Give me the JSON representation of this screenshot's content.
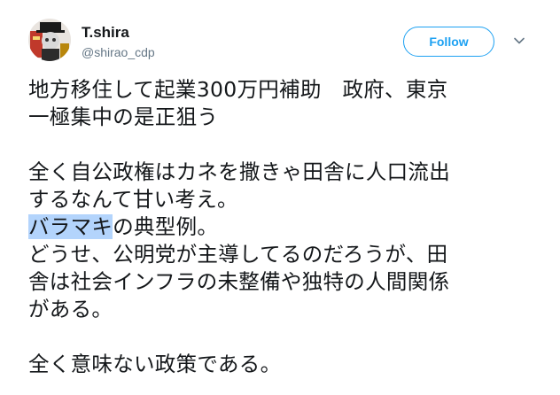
{
  "author": {
    "name": "T.shira",
    "handle": "@shirao_cdp"
  },
  "follow_button": {
    "label": "Follow"
  },
  "icons": {
    "avatar": "avatar-image",
    "menu": "chevron-down-icon"
  },
  "colors": {
    "accent": "#1da1f2",
    "text": "#14171a",
    "secondary": "#657786",
    "selection": "#b3d4fc"
  },
  "tweet": {
    "lines": {
      "l1": "地方移住して起業300万円補助　政府、東京",
      "l2": "一極集中の是正狙う",
      "l3": "全く自公政権はカネを撒きゃ田舎に人口流出",
      "l4": "するなんて甘い考え。",
      "l5_selected": "バラマキ",
      "l5_rest": "の典型例。",
      "l6": "どうせ、公明党が主導してるのだろうが、田",
      "l7": "舎は社会インフラの未整備や独特の人間関係",
      "l8": "がある。",
      "l9": "全く意味ない政策である。"
    }
  }
}
